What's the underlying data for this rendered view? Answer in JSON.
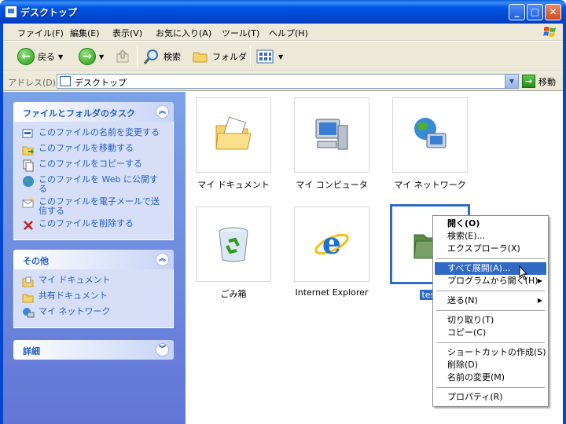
{
  "window": {
    "title": "デスクトップ"
  },
  "menu": [
    "ファイル(F)",
    "編集(E)",
    "表示(V)",
    "お気に入り(A)",
    "ツール(T)",
    "ヘルプ(H)"
  ],
  "toolbar": {
    "back": "戻る",
    "search": "検索",
    "folders": "フォルダ"
  },
  "address": {
    "label": "アドレス(D)",
    "value": "デスクトップ",
    "go": "移動"
  },
  "tasks_panel": {
    "title": "ファイルとフォルダのタスク",
    "items": [
      "このファイルの名前を変更する",
      "このファイルを移動する",
      "このファイルをコピーする",
      "このファイルを Web に公開する",
      "このファイルを電子メールで送信する",
      "このファイルを削除する"
    ]
  },
  "other_panel": {
    "title": "その他",
    "items": [
      "マイ ドキュメント",
      "共有ドキュメント",
      "マイ ネットワーク"
    ]
  },
  "details_panel": {
    "title": "詳細"
  },
  "items": [
    {
      "label": "マイ ドキュメント",
      "icon": "folder-documents-icon"
    },
    {
      "label": "マイ コンピュータ",
      "icon": "computer-icon"
    },
    {
      "label": "マイ ネットワーク",
      "icon": "network-icon"
    },
    {
      "label": "ごみ箱",
      "icon": "recycle-bin-icon"
    },
    {
      "label": "Internet Explorer",
      "icon": "ie-icon"
    },
    {
      "label": "test",
      "icon": "zip-folder-icon"
    }
  ],
  "context_menu": {
    "open": "開く(O)",
    "search": "検索(E)...",
    "explorer": "エクスプローラ(X)",
    "extract_all": "すべて展開(A)...",
    "open_with": "プログラムから開く(H)",
    "send_to": "送る(N)",
    "cut": "切り取り(T)",
    "copy": "コピー(C)",
    "create_shortcut": "ショートカットの作成(S)",
    "delete": "削除(D)",
    "rename": "名前の変更(M)",
    "properties": "プロパティ(R)"
  },
  "colors": {
    "titlebar": "#0058e6",
    "highlight": "#316ac5",
    "task_link": "#215dc6"
  }
}
